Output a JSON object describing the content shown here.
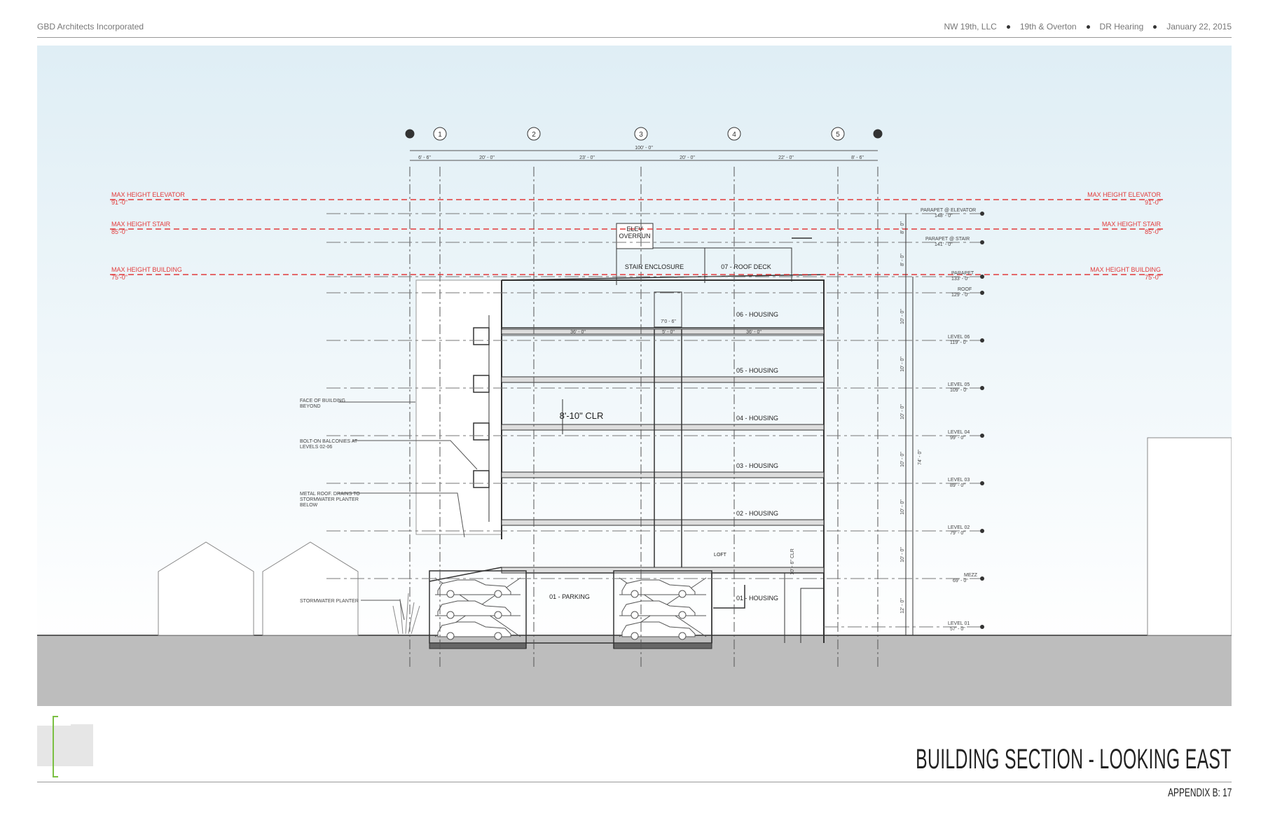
{
  "header": {
    "firm": "GBD Architects Incorporated",
    "client": "NW 19th, LLC",
    "project": "19th & Overton",
    "meeting": "DR Hearing",
    "date": "January 22, 2015"
  },
  "sheet": {
    "title": "BUILDING SECTION - LOOKING EAST",
    "number": "APPENDIX B: 17"
  },
  "grid": {
    "labels": [
      "1",
      "2",
      "3",
      "4",
      "5"
    ],
    "overall": "100' - 0\"",
    "spacings": [
      "6' - 6\"",
      "20' - 0\"",
      "23' - 0\"",
      "20' - 0\"",
      "22' - 0\"",
      "8' - 6\""
    ]
  },
  "max_heights": {
    "elevator": {
      "label": "MAX HEIGHT ELEVATOR",
      "value": "91'-0\""
    },
    "stair": {
      "label": "MAX HEIGHT STAIR",
      "value": "85'-0\""
    },
    "building": {
      "label": "MAX HEIGHT BUILDING",
      "value": "75'-0\""
    }
  },
  "rooms": {
    "elev_overrun_1": "ELEV",
    "elev_overrun_2": "OVERRUN",
    "stair_enclosure": "STAIR ENCLOSURE",
    "roof_deck": "07 - ROOF DECK",
    "l6": "06 - HOUSING",
    "l5": "05 - HOUSING",
    "l4": "04 - HOUSING",
    "l3": "03 - HOUSING",
    "l2": "02 - HOUSING",
    "l1_parking": "01 - PARKING",
    "l1_housing": "01 - HOUSING",
    "loft": "LOFT",
    "clr": "8'-10\" CLR"
  },
  "inner_dims": {
    "left": "36' - 0\"",
    "mid_top": "7'0 - 6\"",
    "mid": "5' - 0\"",
    "right": "36' - 0\""
  },
  "notes": {
    "face_beyond_1": "FACE OF BUILDING",
    "face_beyond_2": "BEYOND",
    "balconies_1": "BOLT-ON BALCONIES AT",
    "balconies_2": "LEVELS 02-06",
    "metal_roof_1": "METAL ROOF. DRAINS TO",
    "metal_roof_2": "STORMWATER PLANTER",
    "metal_roof_3": "BELOW",
    "planter": "STORMWATER PLANTER"
  },
  "levels": [
    {
      "name": "PARAPET @ ELEVATOR",
      "elev": "148' - 0\""
    },
    {
      "name": "PARAPET @ STAIR",
      "elev": "141' - 0\""
    },
    {
      "name": "PARAPET",
      "elev": "133' - 0\""
    },
    {
      "name": "ROOF",
      "elev": "129' - 0\""
    },
    {
      "name": "LEVEL 06",
      "elev": "119' - 0\""
    },
    {
      "name": "LEVEL 05",
      "elev": "109' - 0\""
    },
    {
      "name": "LEVEL 04",
      "elev": "99' - 0\""
    },
    {
      "name": "LEVEL 03",
      "elev": "89' - 0\""
    },
    {
      "name": "LEVEL 02",
      "elev": "79' - 0\""
    },
    {
      "name": "MEZZ",
      "elev": "69' - 0\""
    },
    {
      "name": "LEVEL 01",
      "elev": "57' - 0\""
    }
  ],
  "vert_dims": {
    "overall": "74' - 0\"",
    "floor": "10' - 0\"",
    "ground": "12' - 0\"",
    "mezz_clr": "10' - 6\" CLR",
    "top1": "8' - 0\"",
    "top2": "8' - 0\""
  }
}
